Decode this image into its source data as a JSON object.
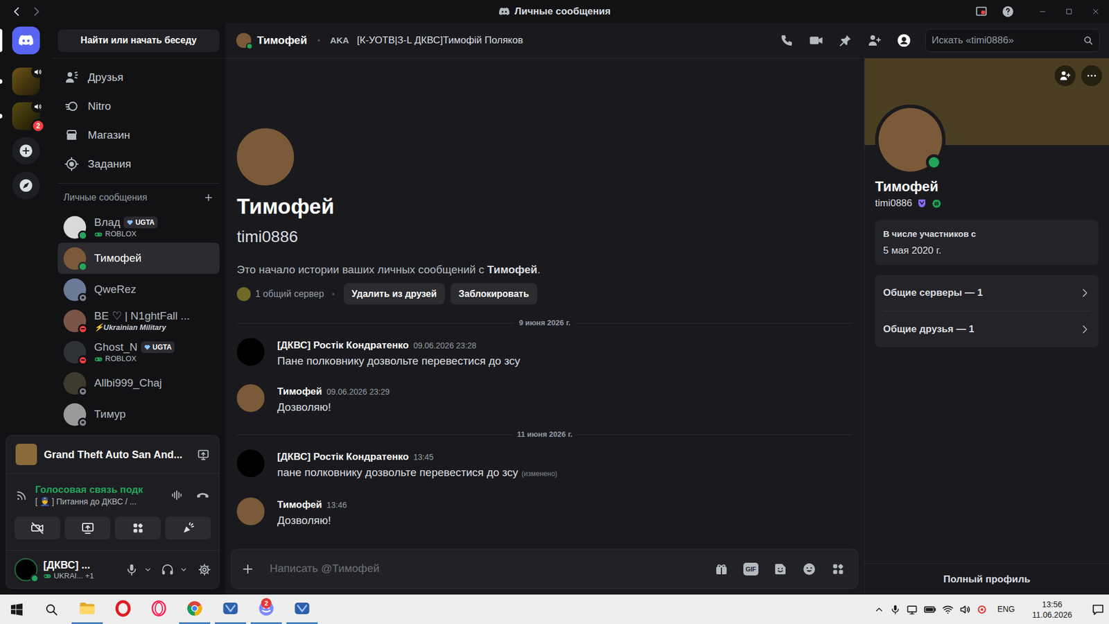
{
  "window": {
    "title": "Личные сообщения"
  },
  "server_rail": {
    "home": {
      "selected": true
    },
    "servers": [
      {
        "unread": true,
        "in_voice": true,
        "selected": false,
        "avatar_color": "#8a7a3a"
      },
      {
        "unread": true,
        "in_voice": true,
        "selected": false,
        "mention_badge": "2",
        "avatar_color": "#6f6a2a"
      }
    ]
  },
  "sidebar": {
    "search_button": "Найти или начать беседу",
    "nav": [
      {
        "label": "Друзья",
        "selected": false
      },
      {
        "label": "Nitro",
        "selected": false
      },
      {
        "label": "Магазин",
        "selected": false
      },
      {
        "label": "Задания",
        "selected": false
      }
    ],
    "dm_header": "Личные сообщения",
    "dms": [
      {
        "name": "Влад",
        "tag": "UGTA",
        "subtitle": "ROBLOX",
        "kind": "game",
        "status": "online",
        "color": "#23a55a",
        "selected": false,
        "avatar_color": "#d9d9d9"
      },
      {
        "name": "Тимофей",
        "kind": "plain",
        "status": "online",
        "color": "#23a55a",
        "selected": true,
        "avatar_color": "#7a5a38"
      },
      {
        "name": "QweRez",
        "kind": "plain",
        "status": "offline",
        "color": "#80848e",
        "selected": false,
        "avatar_color": "#6b7a99"
      },
      {
        "name": "BE ♡ | N1ghtFall ...",
        "subtitle": "⚡Ukrainian Military",
        "kind": "custom",
        "status": "dnd",
        "color": "#f23f43",
        "selected": false,
        "avatar_color": "#7a5548"
      },
      {
        "name": "Ghost_N",
        "tag": "UGTA",
        "subtitle": "ROBLOX",
        "kind": "game",
        "status": "dnd",
        "color": "#f23f43",
        "selected": false,
        "avatar_color": "#2f3336"
      },
      {
        "name": "Allbi999_Chaj",
        "kind": "plain",
        "status": "offline",
        "color": "#80848e",
        "selected": false,
        "avatar_color": "#3d3a30"
      },
      {
        "name": "Тимур",
        "kind": "plain",
        "status": "offline",
        "color": "#80848e",
        "selected": false,
        "avatar_color": "#9a9a9a"
      }
    ]
  },
  "activity_panel": {
    "game": "Grand Theft Auto San And..."
  },
  "voice_panel": {
    "status": "Голосовая связь подк",
    "channel": "[ 👮 ] Питання до ДКВС / ..."
  },
  "user_panel": {
    "name": "[ДКВС] ...",
    "subtitle": "UKRAI...",
    "extra": "+1",
    "status": "online",
    "color": "#23a55a"
  },
  "chat_header": {
    "name": "Тимофей",
    "aka_label": "AKA",
    "aka_name": "[К-УОТВ|З-L ДКВС]Тимофій Поляков",
    "status": "online",
    "color": "#23a55a",
    "profile_panel_open": true,
    "search_placeholder": "Искать «timi0886»"
  },
  "intro": {
    "name": "Тимофей",
    "username": "timi0886",
    "text_before": "Это начало истории ваших личных сообщений с ",
    "text_name": "Тимофей",
    "text_after": ".",
    "mutual_servers": "1 общий сервер",
    "buttons": [
      "Удалить из друзей",
      "Заблокировать"
    ]
  },
  "chat": {
    "items": [
      {
        "kind": "divider",
        "label": "9 июня 2026 г."
      },
      {
        "kind": "message",
        "author": "[ДКВС] Ростік Кондратенко",
        "time": "09.06.2026 23:28",
        "text": "Пане полковнику дозвольте перевестися до зсу",
        "avatar_color": "#000000"
      },
      {
        "kind": "message",
        "author": "Тимофей",
        "time": "09.06.2026 23:29",
        "text": "Дозволяю!",
        "avatar_color": "#7a5a38"
      },
      {
        "kind": "divider",
        "label": "11 июня 2026 г."
      },
      {
        "kind": "message",
        "author": "[ДКВС] Ростік Кондратенко",
        "time": "13:45",
        "text": "пане полковнику дозвольте перевестися до зсу",
        "edited": "(изменено)",
        "avatar_color": "#000000"
      },
      {
        "kind": "message",
        "author": "Тимофей",
        "time": "13:46",
        "text": "Дозволяю!",
        "avatar_color": "#7a5a38"
      }
    ]
  },
  "composer": {
    "placeholder": "Написать @Тимофей",
    "gif": "GIF"
  },
  "profile": {
    "name": "Тимофей",
    "username": "timi0886",
    "status": "online",
    "color": "#23a55a",
    "banner_color": "#4a3e22",
    "member_since_label": "В числе участников с",
    "member_since": "5 мая 2020 г.",
    "rows": [
      "Общие серверы — 1",
      "Общие друзья — 1"
    ],
    "full_profile": "Полный профиль"
  },
  "taskbar": {
    "apps": [
      {
        "kind": "explorer",
        "running": true
      },
      {
        "kind": "opera",
        "running": false
      },
      {
        "kind": "opera-gx",
        "running": false
      },
      {
        "kind": "chrome",
        "running": true
      },
      {
        "kind": "ug",
        "running": true
      },
      {
        "kind": "discord",
        "running": true,
        "badge": "2"
      },
      {
        "kind": "ug",
        "running": true
      }
    ],
    "language": "ENG",
    "time": "13:56",
    "date": "11.06.2026"
  }
}
